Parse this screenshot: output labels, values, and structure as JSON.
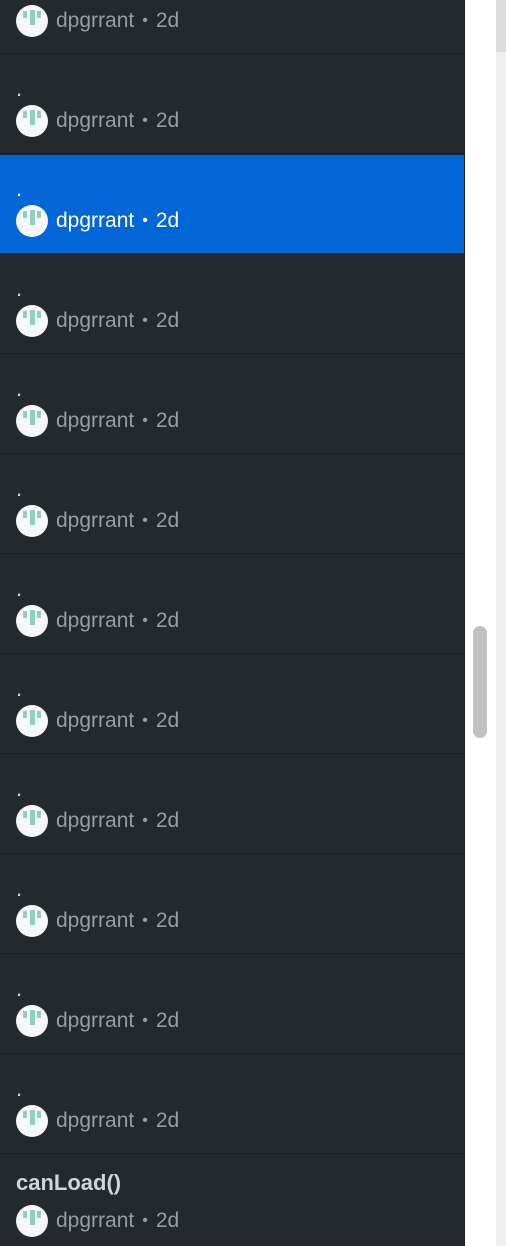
{
  "items": [
    {
      "title": "",
      "author": "dpgrrant",
      "sep": "•",
      "age": "2d",
      "selected": false
    },
    {
      "title": ".",
      "author": "dpgrrant",
      "sep": "•",
      "age": "2d",
      "selected": false
    },
    {
      "title": ".",
      "author": "dpgrrant",
      "sep": "•",
      "age": "2d",
      "selected": true
    },
    {
      "title": ".",
      "author": "dpgrrant",
      "sep": "•",
      "age": "2d",
      "selected": false
    },
    {
      "title": ".",
      "author": "dpgrrant",
      "sep": "•",
      "age": "2d",
      "selected": false
    },
    {
      "title": ".",
      "author": "dpgrrant",
      "sep": "•",
      "age": "2d",
      "selected": false
    },
    {
      "title": ".",
      "author": "dpgrrant",
      "sep": "•",
      "age": "2d",
      "selected": false
    },
    {
      "title": ".",
      "author": "dpgrrant",
      "sep": "•",
      "age": "2d",
      "selected": false
    },
    {
      "title": ".",
      "author": "dpgrrant",
      "sep": "•",
      "age": "2d",
      "selected": false
    },
    {
      "title": ".",
      "author": "dpgrrant",
      "sep": "•",
      "age": "2d",
      "selected": false
    },
    {
      "title": ".",
      "author": "dpgrrant",
      "sep": "•",
      "age": "2d",
      "selected": false
    },
    {
      "title": ".",
      "author": "dpgrrant",
      "sep": "•",
      "age": "2d",
      "selected": false
    },
    {
      "title": "canLoad()",
      "author": "dpgrrant",
      "sep": "•",
      "age": "2d",
      "selected": false
    }
  ],
  "avatar_icon": "identicon-avatar",
  "colors": {
    "panel": "#24292e",
    "selected": "#0366d6",
    "meta": "#959da5"
  }
}
